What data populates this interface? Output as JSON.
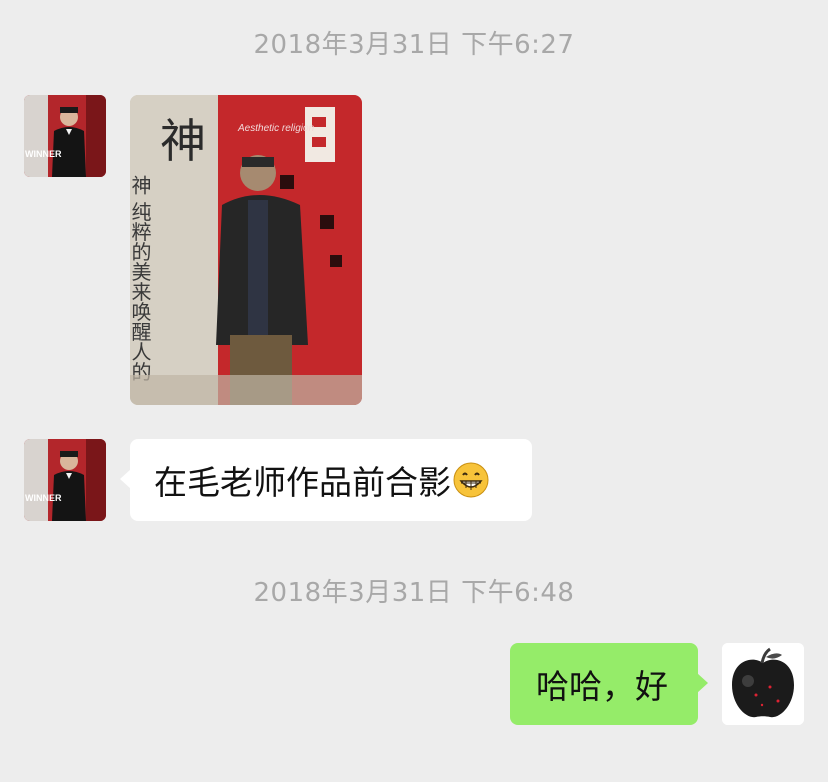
{
  "chat": {
    "timestamp_1": "2018年3月31日 下午6:27",
    "timestamp_2": "2018年3月31日 下午6:48",
    "message_1_text": "在毛老师作品前合影",
    "message_1_emoji": "grin-emoji",
    "message_2_text": "哈哈，好",
    "photo_poster_text": "神 纯粹的美来唤醒人的",
    "photo_poster_text_latin": "Aesthetic religion",
    "contact_avatar_caption": "WINNER"
  },
  "colors": {
    "background": "#ededed",
    "incoming_bubble": "#ffffff",
    "outgoing_bubble": "#95ec69",
    "timestamp_text": "#a8a8a8"
  }
}
